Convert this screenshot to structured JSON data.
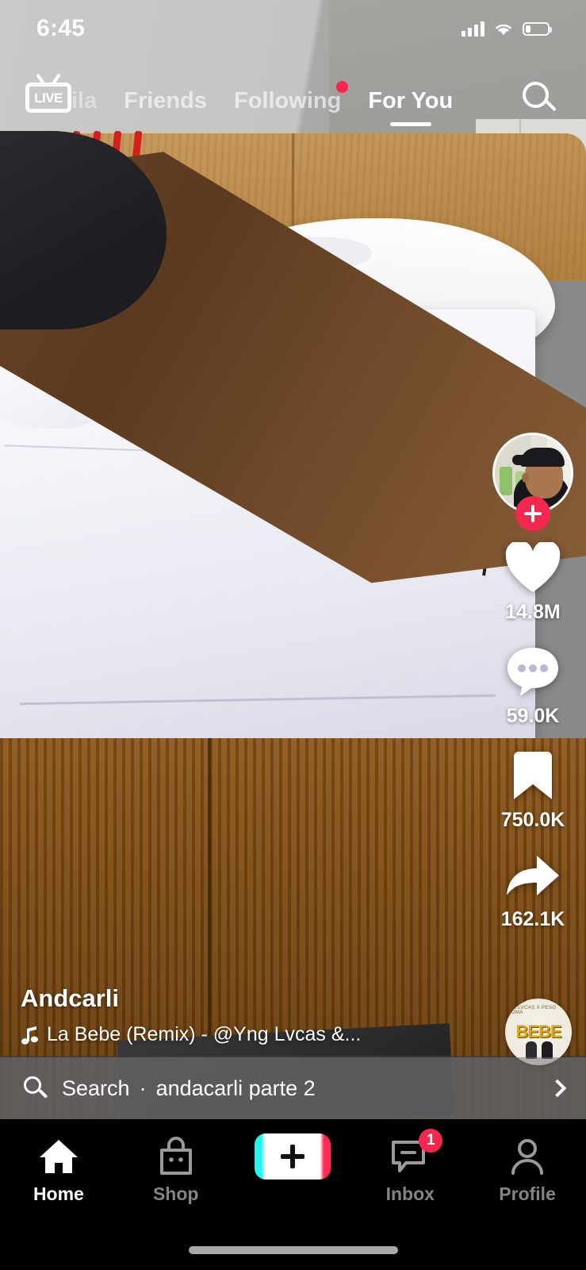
{
  "status_bar": {
    "time": "6:45",
    "signal_icon": "cellular-bars-icon",
    "wifi_icon": "wifi-icon",
    "battery_icon": "battery-icon"
  },
  "top_nav": {
    "live_label": "LIVE",
    "live_icon": "live-tv-icon",
    "search_icon": "search-icon",
    "tabs": [
      {
        "label": "ila",
        "active": false,
        "partial": true,
        "dot": false
      },
      {
        "label": "Friends",
        "active": false,
        "partial": false,
        "dot": false
      },
      {
        "label": "Following",
        "active": false,
        "partial": false,
        "dot": true
      },
      {
        "label": "For You",
        "active": true,
        "partial": false,
        "dot": false
      }
    ]
  },
  "action_rail": {
    "follow_icon": "plus-follow-icon",
    "avatar": "creator-avatar",
    "actions": [
      {
        "icon": "heart-icon",
        "count": "14.8M",
        "name": "like-button"
      },
      {
        "icon": "comment-bubble-icon",
        "count": "59.0K",
        "name": "comment-button"
      },
      {
        "icon": "bookmark-icon",
        "count": "750.0K",
        "name": "bookmark-button"
      },
      {
        "icon": "share-arrow-icon",
        "count": "162.1K",
        "name": "share-button"
      }
    ]
  },
  "caption": {
    "username": "Andcarli",
    "music_icon": "music-note-icon",
    "music_text": "La Bebe (Remix) - @Yng Lvcas &...",
    "album_title": "BEBE",
    "album_sub": "YNG LVCAS X PESO PLUMA"
  },
  "search_bar": {
    "icon": "search-icon",
    "label": "Search",
    "separator": "·",
    "query": "andacarli parte 2",
    "chevron_icon": "chevron-right-icon"
  },
  "bottom_nav": {
    "items": [
      {
        "label": "Home",
        "icon": "home-icon",
        "active": true,
        "badge": ""
      },
      {
        "label": "Shop",
        "icon": "shopping-bag-icon",
        "active": false,
        "badge": ""
      },
      {
        "label": "",
        "icon": "create-plus-icon",
        "active": false,
        "badge": ""
      },
      {
        "label": "Inbox",
        "icon": "inbox-message-icon",
        "active": false,
        "badge": "1"
      },
      {
        "label": "Profile",
        "icon": "profile-person-icon",
        "active": false,
        "badge": ""
      }
    ]
  },
  "colors": {
    "accent_red": "#f4274f",
    "tiktok_cyan": "#25f4ee",
    "tiktok_pink": "#fe2c55",
    "white": "#ffffff"
  }
}
